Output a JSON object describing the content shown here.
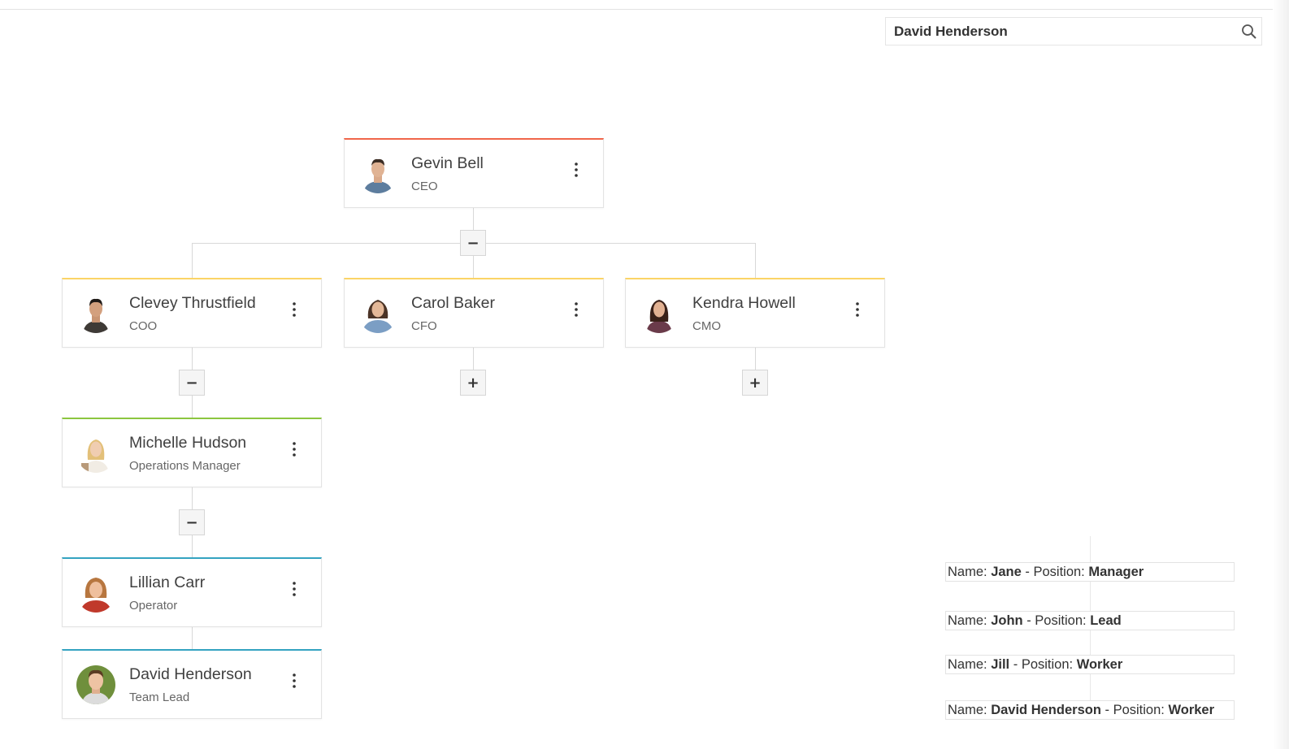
{
  "search": {
    "value": "David Henderson"
  },
  "toggle": {
    "collapse": "−",
    "expand": "+"
  },
  "nodes": [
    {
      "name": "Gevin Bell",
      "title": "CEO",
      "color": "#f0664a"
    },
    {
      "name": "Clevey Thrustfield",
      "title": "COO",
      "color": "#fbd466"
    },
    {
      "name": "Carol Baker",
      "title": "CFO",
      "color": "#fbd466"
    },
    {
      "name": "Kendra Howell",
      "title": "CMO",
      "color": "#fbd466"
    },
    {
      "name": "Michelle Hudson",
      "title": "Operations Manager",
      "color": "#8cc63f"
    },
    {
      "name": "Lillian Carr",
      "title": "Operator",
      "color": "#34a3c1"
    },
    {
      "name": "David Henderson",
      "title": "Team Lead",
      "color": "#34a3c1"
    }
  ],
  "info": {
    "name_label": "Name:",
    "position_label": "- Position:",
    "rows": [
      {
        "name": "Jane",
        "position": "Manager"
      },
      {
        "name": "John",
        "position": "Lead"
      },
      {
        "name": "Jill",
        "position": "Worker"
      },
      {
        "name": "David Henderson",
        "position": "Worker"
      }
    ]
  }
}
